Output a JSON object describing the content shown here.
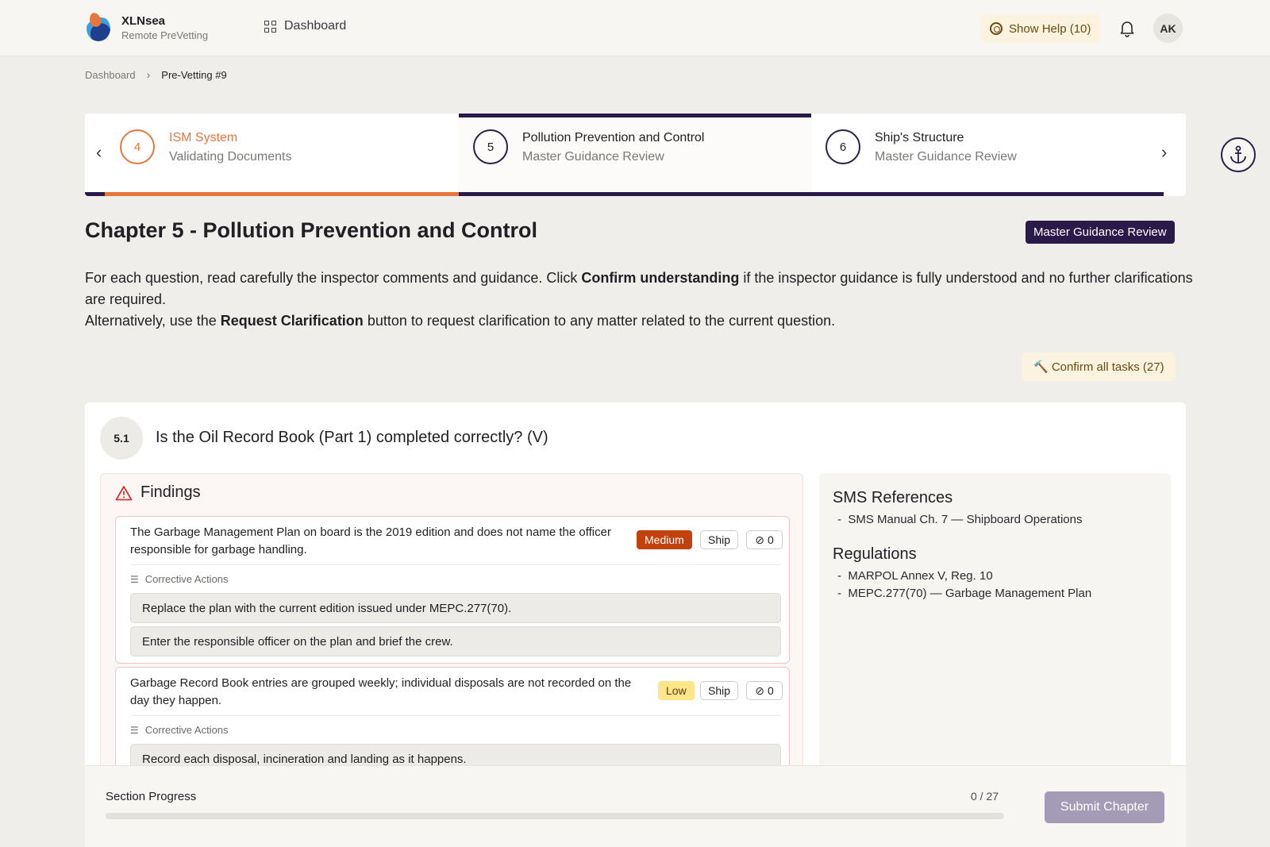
{
  "app": {
    "name": "XLNsea",
    "subtitle": "Remote PreVetting"
  },
  "nav": {
    "dashboard": "Dashboard"
  },
  "header": {
    "help_label": "Show Help (10)",
    "avatar_initials": "AK"
  },
  "breadcrumb": {
    "home": "Dashboard",
    "current": "Pre-Vetting #9"
  },
  "steps": [
    {
      "number": "4",
      "title": "ISM System",
      "subtitle": "Validating Documents",
      "state": "in-progress"
    },
    {
      "number": "5",
      "title": "Pollution Prevention and Control",
      "subtitle": "Master Guidance Review",
      "state": "active"
    },
    {
      "number": "6",
      "title": "Ship's Structure",
      "subtitle": "Master Guidance Review",
      "state": "pending"
    }
  ],
  "chapter": {
    "title": "Chapter 5 - Pollution Prevention and Control",
    "badge": "Master Guidance Review",
    "intro_1a": "For each question, read carefully the inspector comments and guidance. Click ",
    "intro_1b": "Confirm understanding",
    "intro_1c": " if the inspector guidance is fully understood and no further clarifications are required.",
    "intro_2a": "Alternatively, use the ",
    "intro_2b": "Request Clarification",
    "intro_2c": " button to request clarification to any matter related to the current question.",
    "confirm_all": "🔨 Confirm all tasks (27)"
  },
  "question": {
    "number": "5.1",
    "text": "Is the Oil Record Book (Part 1) completed correctly? (V)",
    "findings_title": "Findings",
    "corrective_label": "Corrective Actions",
    "findings": [
      {
        "text": "The Garbage Management Plan on board is the 2019 edition and does not name the officer responsible for garbage handling.",
        "severity": "Medium",
        "source": "Ship",
        "attachments": "0",
        "actions": [
          "Replace the plan with the current edition issued under MEPC.277(70).",
          "Enter the responsible officer on the plan and brief the crew."
        ]
      },
      {
        "text": "Garbage Record Book entries are grouped weekly; individual disposals are not recorded on the day they happen.",
        "severity": "Low",
        "source": "Ship",
        "attachments": "0",
        "actions": [
          "Record each disposal, incineration and landing as it happens."
        ]
      }
    ],
    "sms_title": "SMS References",
    "sms_refs": [
      "SMS Manual Ch. 7 — Shipboard Operations"
    ],
    "reg_title": "Regulations",
    "regulations": [
      "MARPOL Annex V, Reg. 10",
      "MEPC.277(70) — Garbage Management Plan"
    ]
  },
  "progress": {
    "label": "Section Progress",
    "count": "0 / 27",
    "fraction": 0,
    "submit": "Submit Chapter"
  },
  "colors": {
    "accent_dark": "#2a1a4a",
    "orange": "#e8763c",
    "medium": "#c2410c",
    "low": "#fde68a"
  }
}
